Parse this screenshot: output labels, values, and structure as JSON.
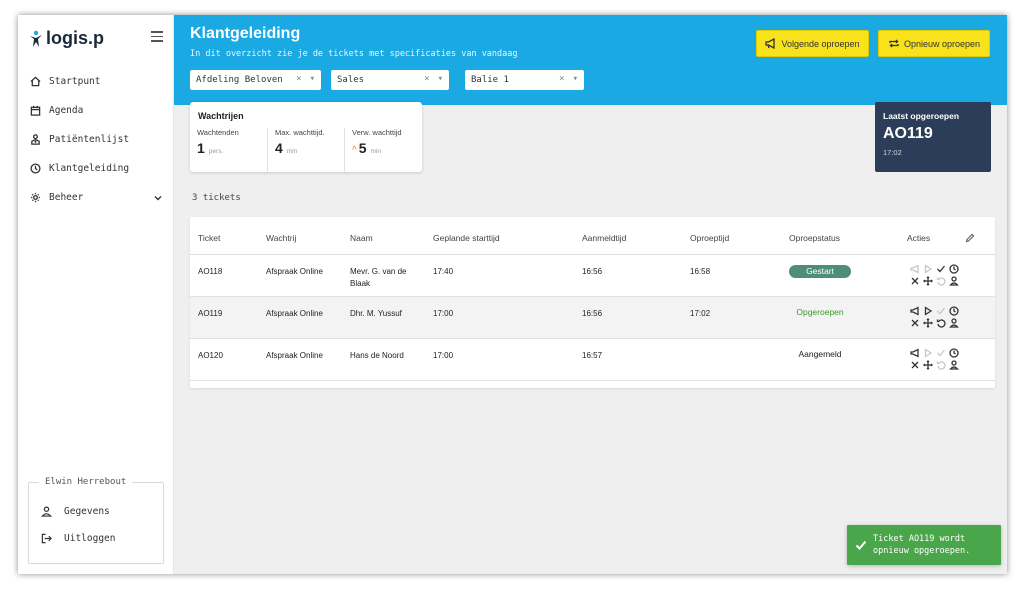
{
  "app": {
    "logo_text": "logis.p"
  },
  "sidebar": {
    "items": [
      {
        "label": "Startpunt",
        "icon": "home-icon"
      },
      {
        "label": "Agenda",
        "icon": "calendar-icon"
      },
      {
        "label": "Patiëntenlijst",
        "icon": "patients-icon"
      },
      {
        "label": "Klantgeleiding",
        "icon": "clock-icon"
      },
      {
        "label": "Beheer",
        "icon": "gear-icon"
      }
    ],
    "user": {
      "name": "Elwin Herrebout",
      "details_label": "Gegevens",
      "logout_label": "Uitloggen"
    }
  },
  "header": {
    "title": "Klantgeleiding",
    "subtitle": "In dit overzicht zie je de tickets met specificaties van vandaag",
    "filters": [
      {
        "value": "Afdeling Beloven"
      },
      {
        "value": "Sales"
      },
      {
        "value": "Balie 1"
      }
    ],
    "next_button": "Volgende oproepen",
    "recall_button": "Opnieuw oproepen"
  },
  "queue": {
    "title": "Wachtrijen",
    "waiting_label": "Wachtenden",
    "waiting_value": "1",
    "waiting_unit": "pers.",
    "max_label": "Max. wachttijd.",
    "max_value": "4",
    "max_unit": "min",
    "expected_label": "Verw. wachttijd",
    "expected_value": "5",
    "expected_unit": "min"
  },
  "last_called": {
    "title": "Laatst opgeroepen",
    "ticket": "AO119",
    "time": "17:02"
  },
  "tickets_count": "3 tickets",
  "table": {
    "columns": [
      "Ticket",
      "Wachtrij",
      "Naam",
      "Geplande starttijd",
      "Aanmeldtijd",
      "Oproeptijd",
      "Oproepstatus",
      "Acties"
    ],
    "rows": [
      {
        "ticket": "AO118",
        "queue": "Afspraak Online",
        "name": "Mevr. G. van de Blaak",
        "planned": "17:40",
        "registered": "16:56",
        "called": "16:58",
        "status": "Gestart"
      },
      {
        "ticket": "AO119",
        "queue": "Afspraak Online",
        "name": "Dhr. M. Yussuf",
        "planned": "17:00",
        "registered": "16:56",
        "called": "17:02",
        "status": "Opgeroepen"
      },
      {
        "ticket": "AO120",
        "queue": "Afspraak Online",
        "name": "Hans de Noord",
        "planned": "17:00",
        "registered": "16:57",
        "called": "",
        "status": "Aangemeld"
      }
    ]
  },
  "toast": {
    "message": "Ticket AO119 wordt opnieuw opgeroepen."
  },
  "colors": {
    "header": "#1aa9e2",
    "button": "#f7e21b",
    "last_called_bg": "#2b3d58",
    "status_started": "#4f8e76",
    "status_called": "#3a9a2a",
    "toast": "#4aa64a"
  }
}
